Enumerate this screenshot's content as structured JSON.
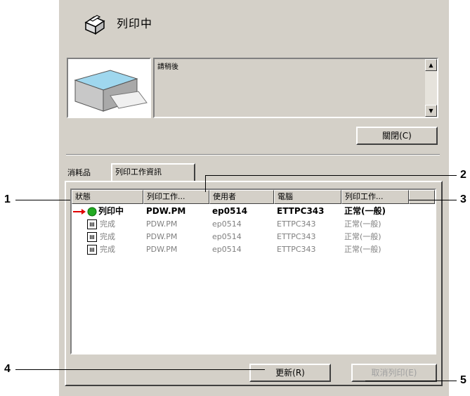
{
  "status": {
    "title": "列印中",
    "message": "請稍後"
  },
  "buttons": {
    "close": "關閉(C)",
    "refresh": "更新(R)",
    "cancel": "取消列印(E)"
  },
  "tabs": [
    {
      "label": "消耗品"
    },
    {
      "label": "列印工作資訊"
    }
  ],
  "columns": [
    "狀態",
    "列印工作...",
    "使用者",
    "電腦",
    "列印工作..."
  ],
  "rows": [
    {
      "status": "列印中",
      "doc": "PDW.PM",
      "user": "ep0514",
      "computer": "ETTPC343",
      "type": "正常(一般)"
    },
    {
      "status": "完成",
      "doc": "PDW.PM",
      "user": "ep0514",
      "computer": "ETTPC343",
      "type": "正常(一般)"
    },
    {
      "status": "完成",
      "doc": "PDW.PM",
      "user": "ep0514",
      "computer": "ETTPC343",
      "type": "正常(一般)"
    },
    {
      "status": "完成",
      "doc": "PDW.PM",
      "user": "ep0514",
      "computer": "ETTPC343",
      "type": "正常(一般)"
    }
  ],
  "callouts": [
    "1",
    "2",
    "3",
    "4",
    "5"
  ],
  "colors": {
    "dialog_bg": "#d4d0c8",
    "arrow_red": "#e00000",
    "status_green": "#22aa22"
  }
}
